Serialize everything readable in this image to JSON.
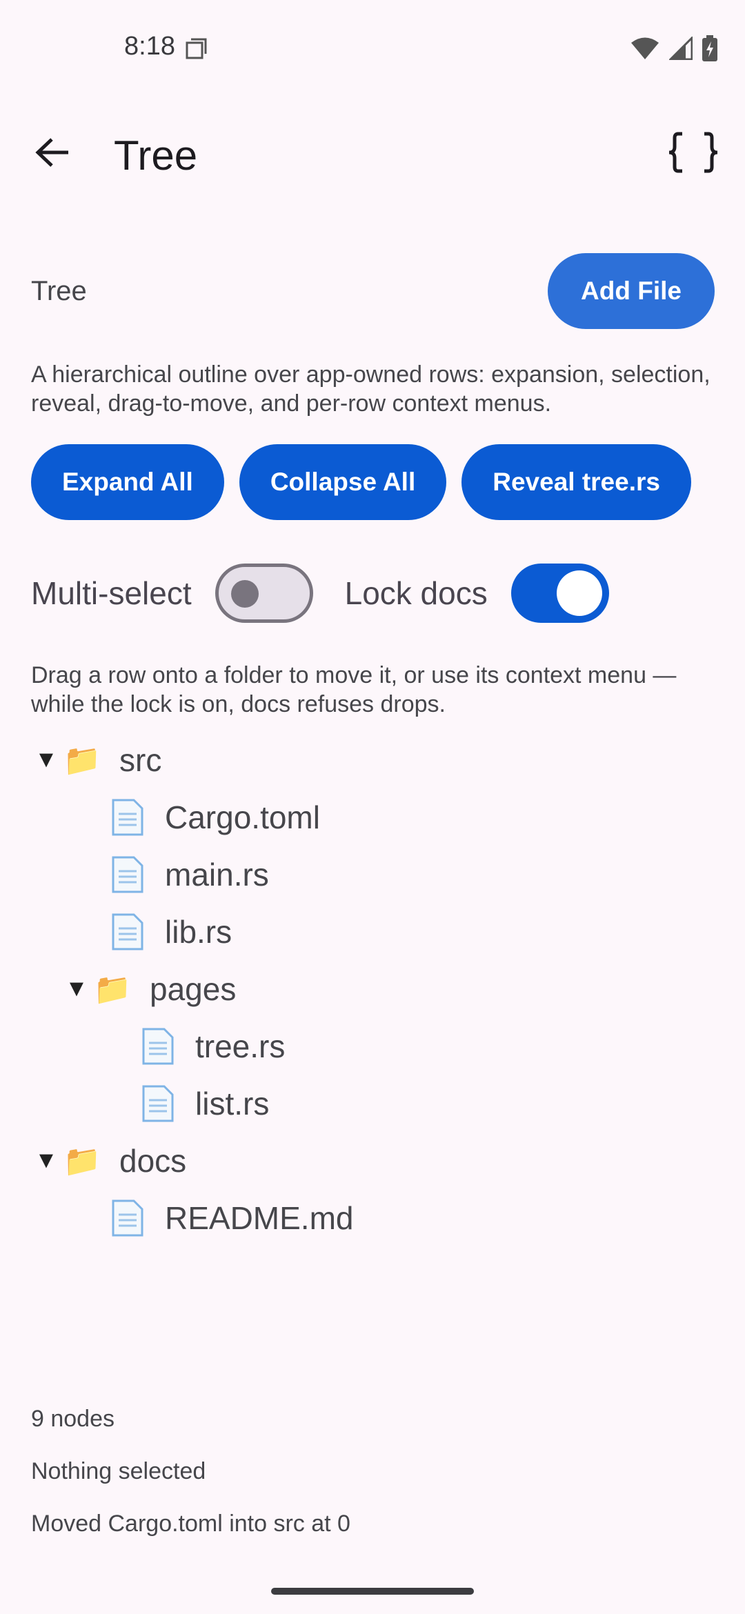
{
  "status_bar": {
    "time": "8:18"
  },
  "app_bar": {
    "title": "Tree"
  },
  "section": {
    "title": "Tree",
    "add_file_label": "Add File",
    "description": "A hierarchical outline over app-owned rows: expansion, selection, reveal, drag-to-move, and per-row context menus."
  },
  "actions": {
    "expand_all": "Expand All",
    "collapse_all": "Collapse All",
    "reveal": "Reveal tree.rs"
  },
  "toggles": {
    "multi_select": {
      "label": "Multi-select",
      "on": false
    },
    "lock_docs": {
      "label": "Lock docs",
      "on": true
    }
  },
  "hint": "Drag a row onto a folder to move it, or use its context menu — while the lock is on, docs refuses drops.",
  "tree": {
    "rows": [
      {
        "label": "src",
        "type": "folder",
        "expanded": true,
        "depth": 0
      },
      {
        "label": "Cargo.toml",
        "type": "file",
        "depth": 1
      },
      {
        "label": "main.rs",
        "type": "file",
        "depth": 1
      },
      {
        "label": "lib.rs",
        "type": "file",
        "depth": 1
      },
      {
        "label": "pages",
        "type": "folder",
        "expanded": true,
        "depth": 1
      },
      {
        "label": "tree.rs",
        "type": "file",
        "depth": 2
      },
      {
        "label": "list.rs",
        "type": "file",
        "depth": 2
      },
      {
        "label": "docs",
        "type": "folder",
        "expanded": true,
        "depth": 0
      },
      {
        "label": "README.md",
        "type": "file",
        "depth": 1
      }
    ]
  },
  "footer": {
    "node_count": "9 nodes",
    "selection": "Nothing selected",
    "last_action": "Moved Cargo.toml into src at 0"
  },
  "colors": {
    "background": "#fdf7fb",
    "primary": "#0b5bd3",
    "add_file": "#2d70d8"
  }
}
